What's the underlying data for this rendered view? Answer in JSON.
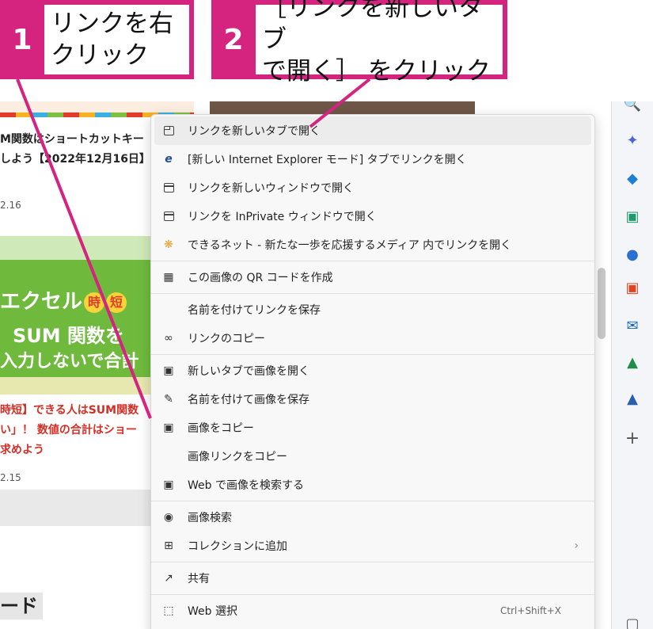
{
  "callouts": [
    {
      "number": "1",
      "text": "リンクを右\nクリック"
    },
    {
      "number": "2",
      "text": "［リンクを新しいタブ\nで開く］ をクリック"
    }
  ],
  "page": {
    "article1_title": "M関数はショートカットキー\nしよう【2022年12月16日】",
    "article1_date": "2.16",
    "thumb_line1": "エクセル",
    "thumb_badge1": "時",
    "thumb_badge2": "短",
    "thumb_line2": "SUM 関数を",
    "thumb_line3": "入力しないで合計",
    "article2_title": "時短】できる人はSUM関数\nい」！ 数値の合計はショー\n求めよう",
    "article2_date": "2.15",
    "section_heading": "ード"
  },
  "context_menu": {
    "items": [
      {
        "icon": "new-tab-icon",
        "label": "リンクを新しいタブで開く",
        "highlighted": true
      },
      {
        "icon": "ie-icon",
        "label": "[新しい Internet Explorer モード] タブでリンクを開く"
      },
      {
        "icon": "new-window-icon",
        "label": "リンクを新しいウィンドウで開く"
      },
      {
        "icon": "inprivate-icon",
        "label": "リンクを InPrivate ウィンドウで開く"
      },
      {
        "icon": "site-icon",
        "label": "できるネット - 新たな一歩を応援するメディア 内でリンクを開く"
      },
      {
        "icon": "qr-icon",
        "label": "この画像の QR コードを作成"
      },
      {
        "icon": "",
        "label": "名前を付けてリンクを保存"
      },
      {
        "icon": "link-icon",
        "label": "リンクのコピー"
      },
      {
        "icon": "image-tab-icon",
        "label": "新しいタブで画像を開く"
      },
      {
        "icon": "save-image-icon",
        "label": "名前を付けて画像を保存"
      },
      {
        "icon": "copy-image-icon",
        "label": "画像をコピー"
      },
      {
        "icon": "",
        "label": "画像リンクをコピー"
      },
      {
        "icon": "web-search-image-icon",
        "label": "Web で画像を検索する"
      },
      {
        "icon": "visual-search-icon",
        "label": "画像検索"
      },
      {
        "icon": "collection-add-icon",
        "label": "コレクションに追加",
        "arrow": "›"
      },
      {
        "icon": "share-icon",
        "label": "共有"
      },
      {
        "icon": "web-select-icon",
        "label": "Web 選択",
        "shortcut": "Ctrl+Shift+X"
      }
    ]
  },
  "colors": {
    "accent": "#d4247f",
    "menu_bg": "#f8f8f8"
  }
}
